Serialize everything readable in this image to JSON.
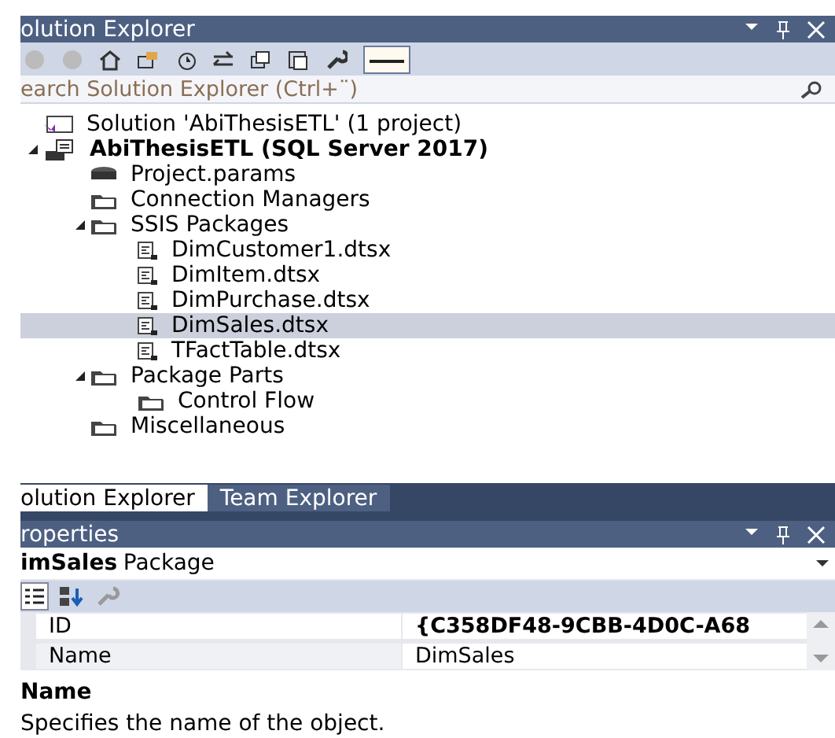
{
  "solution_explorer": {
    "title": "olution Explorer",
    "search": {
      "placeholder": "earch Solution Explorer (Ctrl+¨)"
    },
    "tree": [
      {
        "label": "Solution 'AbiThesisETL' (1 project)",
        "kind": "solution",
        "bold": false,
        "selected": false
      },
      {
        "label": "AbiThesisETL (SQL Server 2017)",
        "kind": "project",
        "bold": true,
        "selected": false,
        "expanded": true,
        "children": [
          {
            "label": "Project.params",
            "kind": "params",
            "bold": false,
            "selected": false
          },
          {
            "label": "Connection Managers",
            "kind": "folder",
            "bold": false,
            "selected": false
          },
          {
            "label": "SSIS Packages",
            "kind": "folder",
            "bold": false,
            "selected": false,
            "expanded": true,
            "children": [
              {
                "label": "DimCustomer1.dtsx",
                "kind": "package",
                "bold": false,
                "selected": false
              },
              {
                "label": "DimItem.dtsx",
                "kind": "package",
                "bold": false,
                "selected": false
              },
              {
                "label": "DimPurchase.dtsx",
                "kind": "package",
                "bold": false,
                "selected": false
              },
              {
                "label": "DimSales.dtsx",
                "kind": "package",
                "bold": false,
                "selected": true
              },
              {
                "label": "TFactTable.dtsx",
                "kind": "package",
                "bold": false,
                "selected": false
              }
            ]
          },
          {
            "label": "Package Parts",
            "kind": "folder",
            "bold": false,
            "selected": false,
            "expanded": true,
            "children": [
              {
                "label": "Control Flow",
                "kind": "folder",
                "bold": false,
                "selected": false
              }
            ]
          },
          {
            "label": "Miscellaneous",
            "kind": "folder",
            "bold": false,
            "selected": false
          }
        ]
      }
    ]
  },
  "tabs": [
    {
      "label": "olution Explorer",
      "selected": true
    },
    {
      "label": "Team Explorer",
      "selected": false
    }
  ],
  "properties": {
    "title": "roperties",
    "object_name": "imSales",
    "object_type": "Package",
    "rows": [
      {
        "name": "ID",
        "value": "{C358DF48-9CBB-4D0C-A68",
        "bold": true
      },
      {
        "name": "Name",
        "value": "DimSales",
        "bold": false
      }
    ],
    "description_title": "Name",
    "description": "Specifies the name of the object."
  }
}
